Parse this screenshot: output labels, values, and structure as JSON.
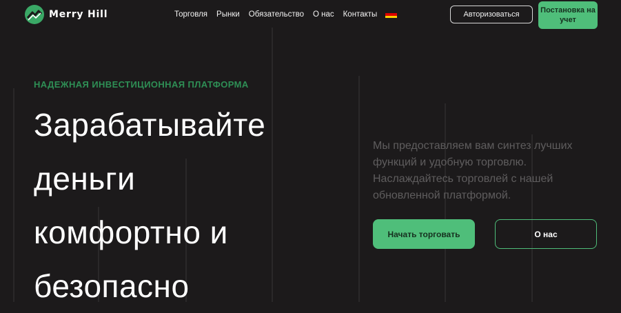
{
  "brand": {
    "name": "Merry Hill",
    "accent": "#4fbe7a",
    "background": "#1c1a1b"
  },
  "nav": {
    "items": [
      "Торговля",
      "Рынки",
      "Обязательство",
      "О нас",
      "Контакты"
    ],
    "language_icon": "german-flag-icon"
  },
  "header": {
    "login_label": "Авторизоваться",
    "signup_label": "Постановка на учет"
  },
  "hero": {
    "tagline": "НАДЕЖНАЯ ИНВЕСТИЦИОННАЯ ПЛАТФОРМА",
    "lines": [
      "Зарабатывайте",
      "деньги",
      "комфортно и",
      "безопасно"
    ],
    "description": "Мы предоставляем вам синтез лучших функций и удобную торговлю. Наслаждайтесь торговлей с нашей обновленной платформой.",
    "start_label": "Начать торговать",
    "about_label": "О нас"
  }
}
